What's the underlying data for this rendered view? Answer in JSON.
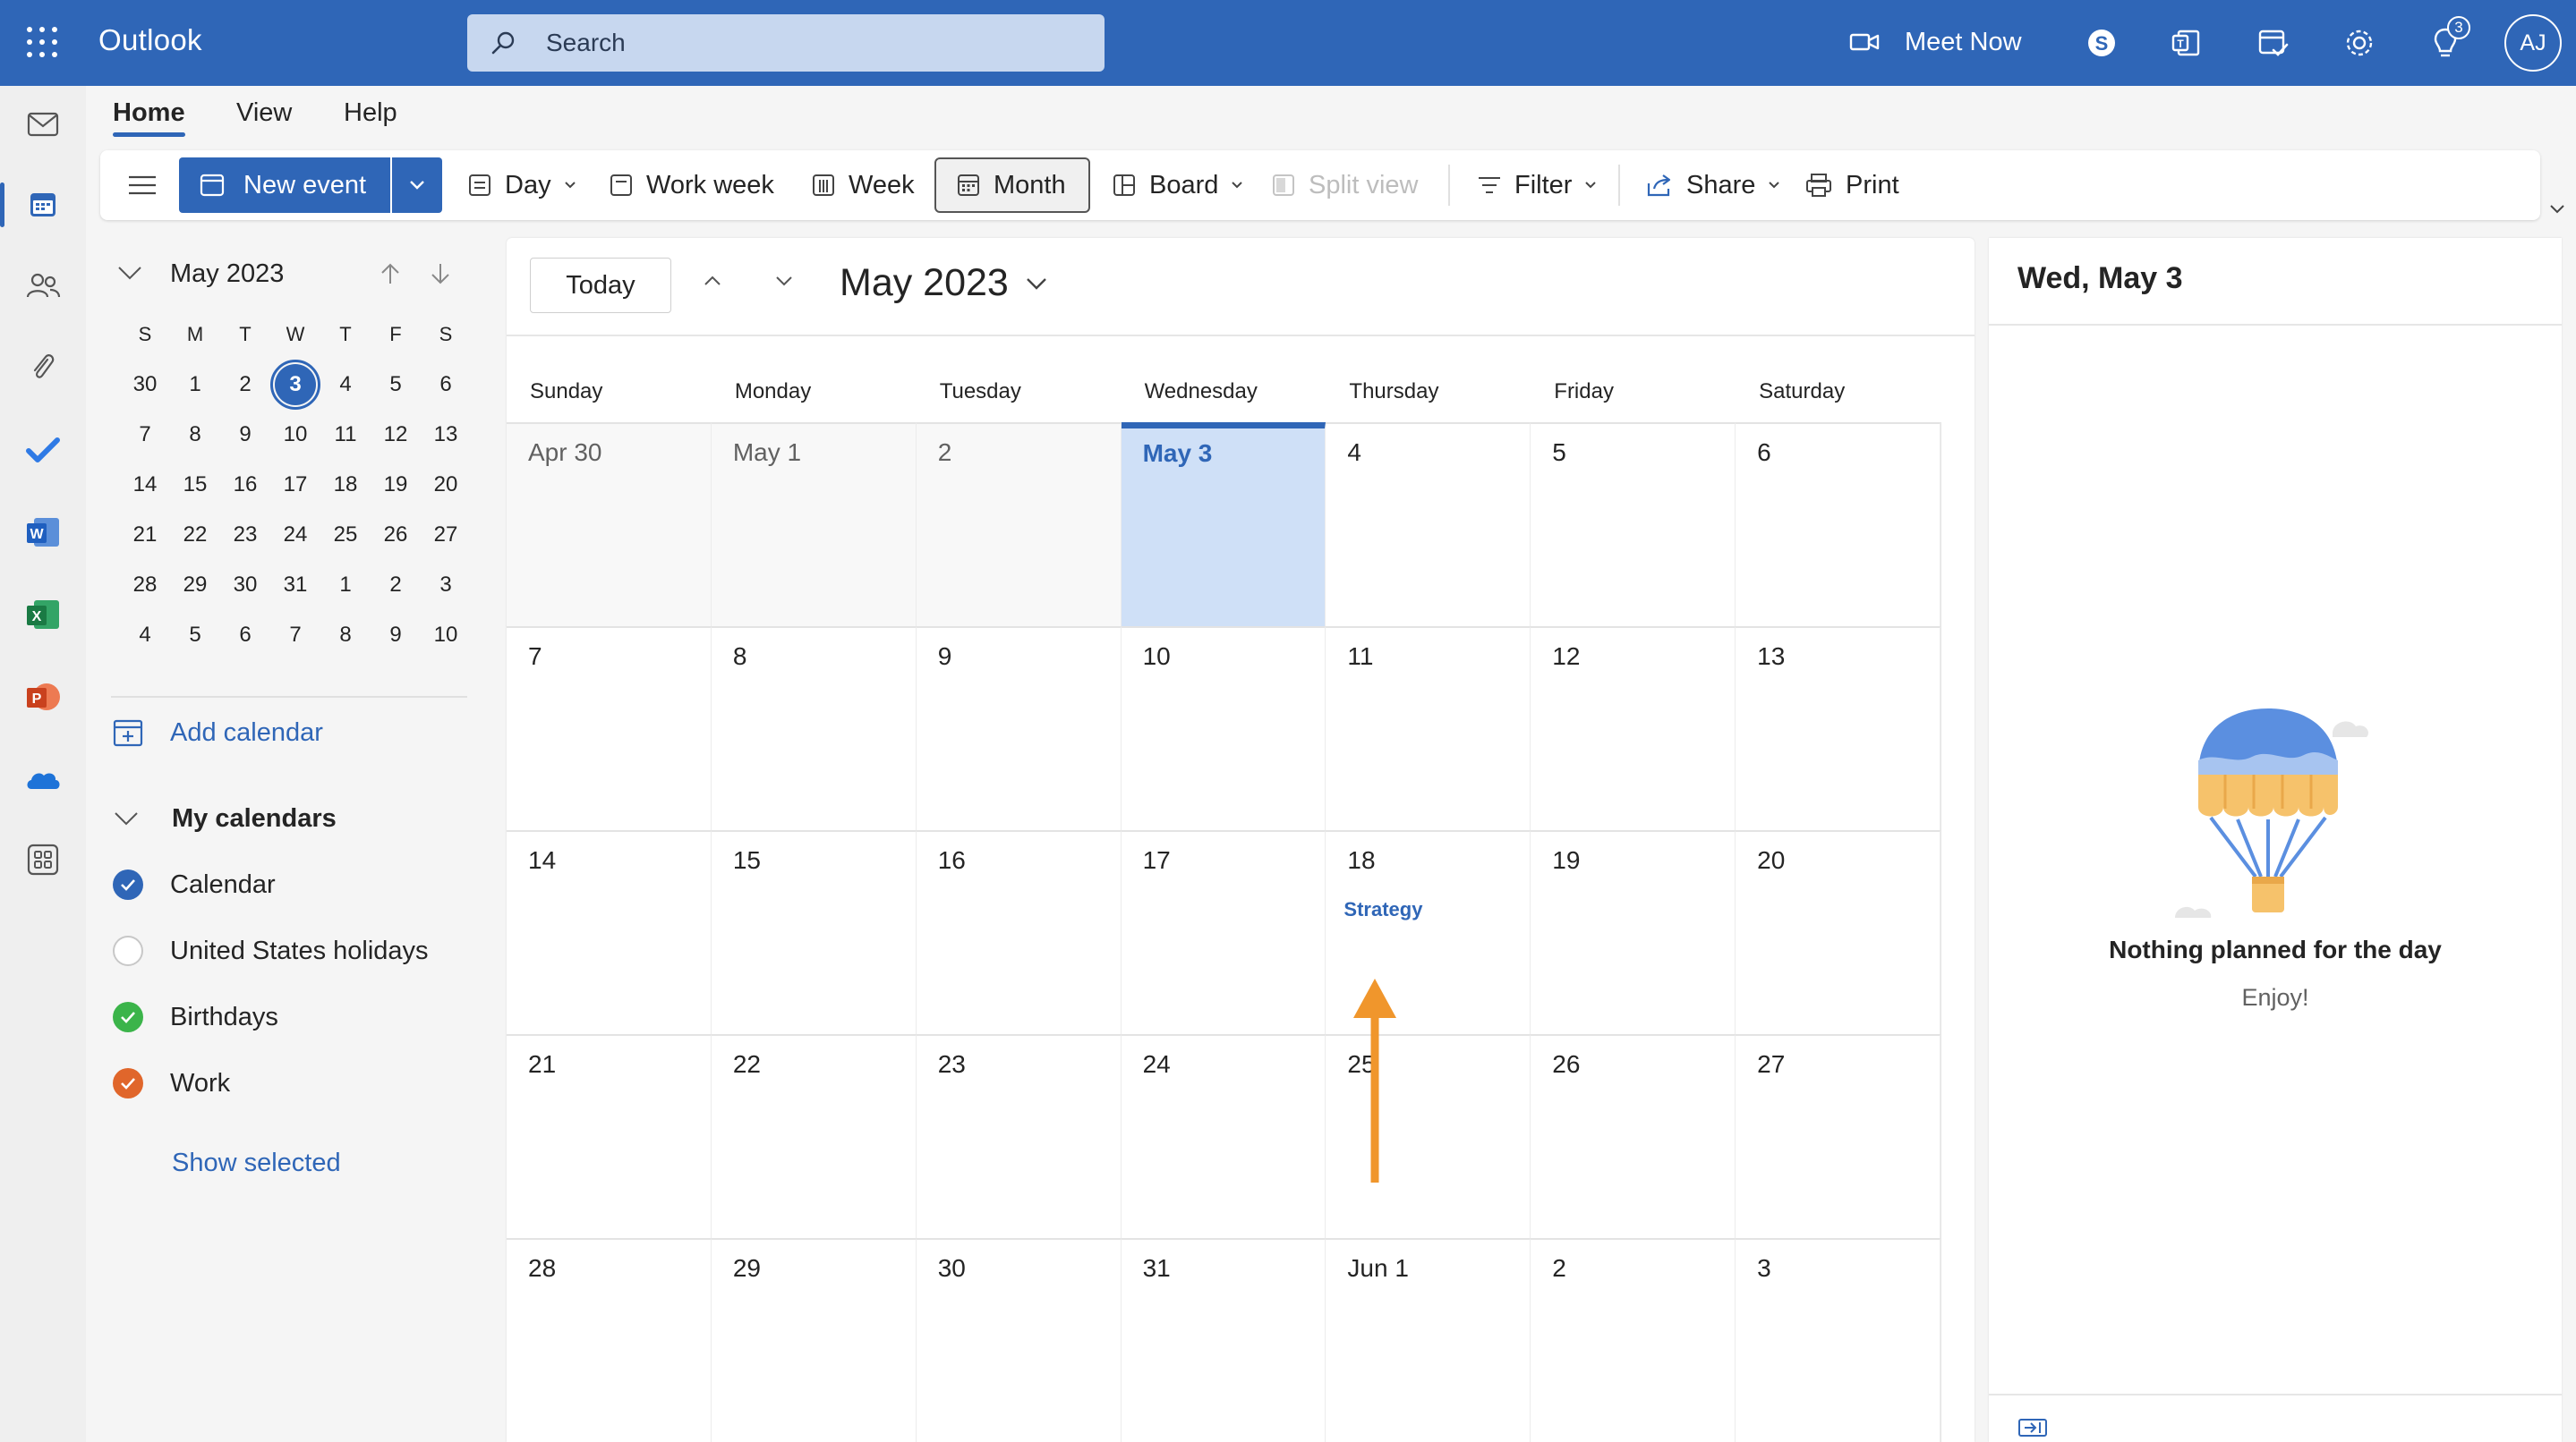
{
  "topbar": {
    "app_title": "Outlook",
    "search_placeholder": "Search",
    "meet_now_label": "Meet Now",
    "notification_count": "3",
    "avatar_initials": "AJ",
    "brand_color": "#2f66b7"
  },
  "tabs": [
    {
      "label": "Home",
      "active": true
    },
    {
      "label": "View",
      "active": false
    },
    {
      "label": "Help",
      "active": false
    }
  ],
  "toolbar": {
    "new_event_label": "New event",
    "day_label": "Day",
    "work_week_label": "Work week",
    "week_label": "Week",
    "month_label": "Month",
    "board_label": "Board",
    "split_view_label": "Split view",
    "filter_label": "Filter",
    "share_label": "Share",
    "print_label": "Print"
  },
  "mini_calendar": {
    "title": "May 2023",
    "weekday_headers": [
      "S",
      "M",
      "T",
      "W",
      "T",
      "F",
      "S"
    ],
    "weeks": [
      [
        "30",
        "1",
        "2",
        "3",
        "4",
        "5",
        "6"
      ],
      [
        "7",
        "8",
        "9",
        "10",
        "11",
        "12",
        "13"
      ],
      [
        "14",
        "15",
        "16",
        "17",
        "18",
        "19",
        "20"
      ],
      [
        "21",
        "22",
        "23",
        "24",
        "25",
        "26",
        "27"
      ],
      [
        "28",
        "29",
        "30",
        "31",
        "1",
        "2",
        "3"
      ],
      [
        "4",
        "5",
        "6",
        "7",
        "8",
        "9",
        "10"
      ]
    ],
    "selected": "3"
  },
  "sidebar": {
    "add_calendar_label": "Add calendar",
    "my_calendars_label": "My calendars",
    "calendars": [
      {
        "label": "Calendar",
        "checked": true,
        "color": "#2f66b7"
      },
      {
        "label": "United States holidays",
        "checked": false,
        "color": "#c8c8c8"
      },
      {
        "label": "Birthdays",
        "checked": true,
        "color": "#3bb44a"
      },
      {
        "label": "Work",
        "checked": true,
        "color": "#e0662b"
      }
    ],
    "show_selected_label": "Show selected"
  },
  "main": {
    "today_label": "Today",
    "month_title": "May 2023",
    "weekdays": [
      "Sunday",
      "Monday",
      "Tuesday",
      "Wednesday",
      "Thursday",
      "Friday",
      "Saturday"
    ],
    "weeks": [
      [
        "Apr 30",
        "May 1",
        "2",
        "May 3",
        "4",
        "5",
        "6"
      ],
      [
        "7",
        "8",
        "9",
        "10",
        "11",
        "12",
        "13"
      ],
      [
        "14",
        "15",
        "16",
        "17",
        "18",
        "19",
        "20"
      ],
      [
        "21",
        "22",
        "23",
        "24",
        "25",
        "26",
        "27"
      ],
      [
        "28",
        "29",
        "30",
        "31",
        "Jun 1",
        "2",
        "3"
      ]
    ],
    "today_date": "May 3",
    "event": {
      "date": "18",
      "title": "Strategy"
    }
  },
  "annotation": {
    "arrow_color": "#f0962c"
  },
  "pane": {
    "title": "Wed, May 3",
    "empty_title": "Nothing planned for the day",
    "empty_subtitle": "Enjoy!"
  }
}
